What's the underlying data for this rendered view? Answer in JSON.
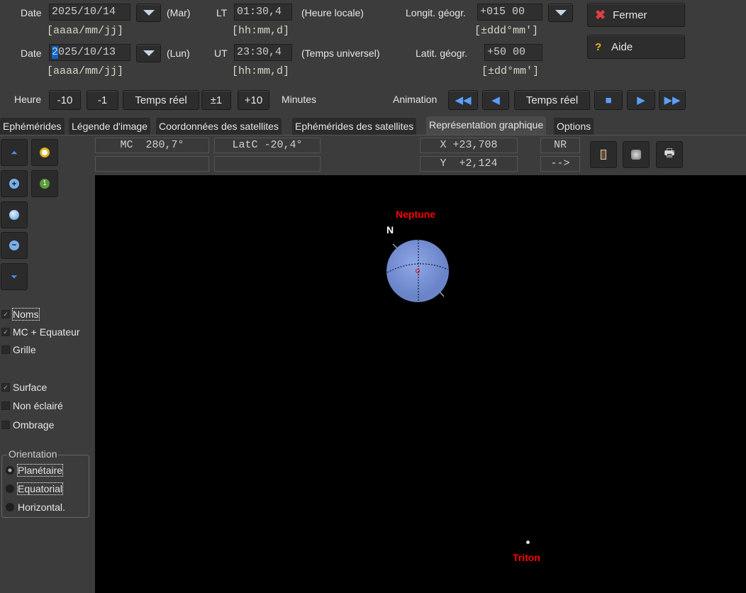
{
  "row1": {
    "date_label": "Date",
    "date": "2025/10/14",
    "day": "(Mar)",
    "time_label": "LT",
    "time": "01:30,4",
    "time_desc": "(Heure locale)",
    "long_label": "Longit. géogr.",
    "long": "+015 00",
    "long_fmt": "[±ddd°mm']"
  },
  "row2": {
    "date_label": "Date",
    "date": "2025/10/13",
    "day": "(Lun)",
    "time_label": "UT",
    "time": "23:30,4",
    "time_desc": "(Temps universel)",
    "lat_label": "Latit. géogr.",
    "lat": "+50 00",
    "lat_fmt": "[±dd°mm']"
  },
  "date_fmt": "[aaaa/mm/jj]",
  "time_fmt": "[hh:mm,d]",
  "buttons": {
    "close": "Fermer",
    "help": "Aide"
  },
  "hour": {
    "label": "Heure",
    "m10": "-10",
    "m1": "-1",
    "realtime": "Temps réel",
    "p1": "±1",
    "p10": "+10",
    "unit": "Minutes"
  },
  "animation": {
    "label": "Animation",
    "realtime": "Temps réel"
  },
  "tabs": [
    "Ephémérides",
    "Légende d'image",
    "Coordonnées des satellites",
    "Ephémérides des satellites",
    "Représentation graphique",
    "Options"
  ],
  "info": {
    "mc": "MC  280,7°",
    "latc": "LatC -20,4°",
    "x": "X +23,708",
    "y": "Y  +2,124",
    "nr": "NR",
    "arrow": "-->"
  },
  "checks": [
    {
      "label": "Noms",
      "checked": true
    },
    {
      "label": "MC + Equateur",
      "checked": true
    },
    {
      "label": "Grille",
      "checked": false
    },
    {
      "label": "Surface",
      "checked": true
    },
    {
      "label": "Non éclairé",
      "checked": false
    },
    {
      "label": "Ombrage",
      "checked": false
    }
  ],
  "orientation": {
    "title": "Orientation",
    "options": [
      "Planétaire",
      "Equatorial",
      "Horizontal."
    ],
    "selected": 0
  },
  "view": {
    "planet": "Neptune",
    "north": "N",
    "moon": "Triton",
    "label_color": "#ff0000"
  }
}
